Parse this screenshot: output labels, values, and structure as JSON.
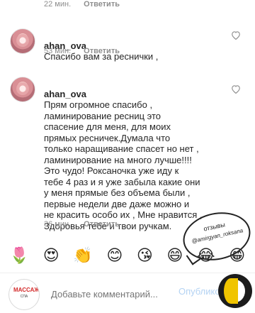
{
  "top_meta": {
    "time": "22 мин.",
    "reply": "Ответить"
  },
  "comments": [
    {
      "username": "ahan_ova",
      "text": "Спасибо вам за реснички ,",
      "time": "53 мин.",
      "reply": "Ответить",
      "like_icon": "heart-outline-icon"
    },
    {
      "username": "ahan_ova",
      "text": "Прям огромное спасибо ,\nламинирование ресниц это\nспасение для меня, для моих\nпрямых ресничек.Думала что\nтолько наращивание спасет но нет ,\nламинирование на много лучше!!!!\nЭто чудо! Роксаночка уже иду к\nтебе 4 раз и я уже забыла какие они\nу меня прямые без объема были ,\nпервые недели две даже можно и\nне красить особо их , Мне нравится ,\nЗдоровья тебе и твои ручкам.",
      "time": "36 мин.",
      "reply": "Ответить",
      "like_icon": "heart-outline-icon"
    }
  ],
  "emoji_bar": [
    {
      "name": "tulip-emoji",
      "glyph": "🌷"
    },
    {
      "name": "heart-eyes-emoji",
      "glyph": "😍"
    },
    {
      "name": "clapping-hands-emoji",
      "glyph": "👏"
    },
    {
      "name": "smiling-face-emoji",
      "glyph": "😊"
    },
    {
      "name": "kissing-face-emoji",
      "glyph": "😘"
    },
    {
      "name": "grinning-face-emoji",
      "glyph": "😄"
    },
    {
      "name": "laughing-face-emoji",
      "glyph": "😂"
    },
    {
      "name": "big-grin-emoji",
      "glyph": "😁"
    }
  ],
  "composer": {
    "placeholder": "Добавьте комментарий...",
    "publish": "Опубликовать",
    "avatar_line1": "МАССАЖ",
    "avatar_line2": "СПА"
  },
  "overlay": {
    "stamp_line1": "отзывы",
    "stamp_line2": "@amirgyan_roksana"
  },
  "colors": {
    "text": "#262626",
    "muted": "#8e8e8e",
    "publish_disabled": "#b4d3f3",
    "logo_yellow": "#f0c400"
  }
}
